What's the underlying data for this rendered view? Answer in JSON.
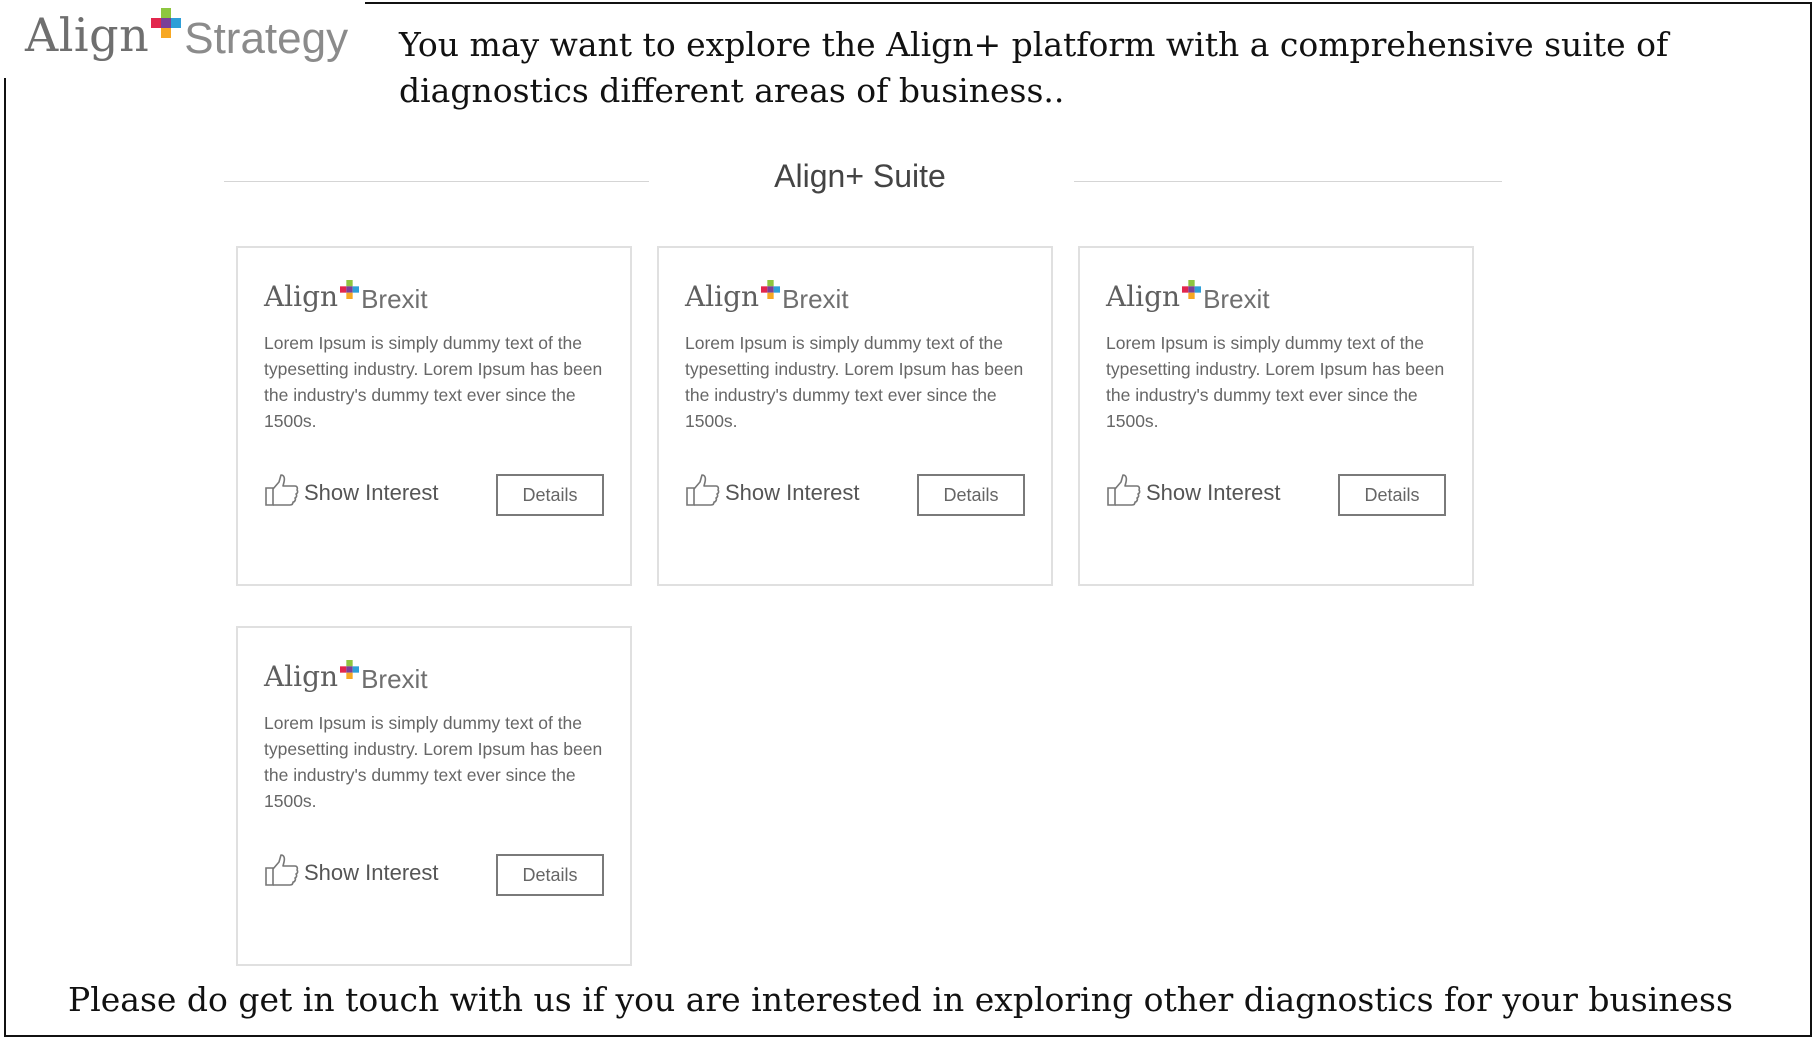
{
  "header": {
    "logo": {
      "brand": "Align",
      "product": "Strategy"
    },
    "intro_text": "You may want to explore the Align+ platform with a comprehensive suite of diagnostics different areas of business.."
  },
  "suite": {
    "title": "Align+ Suite",
    "cards": [
      {
        "logo_brand": "Align",
        "logo_product": "Brexit",
        "description": "Lorem Ipsum is simply dummy text of the typesetting industry. Lorem Ipsum has been the industry's dummy text ever since the 1500s.",
        "show_interest_label": "Show Interest",
        "details_label": "Details"
      },
      {
        "logo_brand": "Align",
        "logo_product": "Brexit",
        "description": "Lorem Ipsum is simply dummy text of the typesetting industry. Lorem Ipsum has been the industry's dummy text ever since the 1500s.",
        "show_interest_label": "Show Interest",
        "details_label": "Details"
      },
      {
        "logo_brand": "Align",
        "logo_product": "Brexit",
        "description": "Lorem Ipsum is simply dummy text of the typesetting industry. Lorem Ipsum has been the industry's dummy text ever since the 1500s.",
        "show_interest_label": "Show Interest",
        "details_label": "Details"
      },
      {
        "logo_brand": "Align",
        "logo_product": "Brexit",
        "description": "Lorem Ipsum is simply dummy text of the typesetting industry. Lorem Ipsum has been the industry's dummy text ever since the 1500s.",
        "show_interest_label": "Show Interest",
        "details_label": "Details"
      }
    ]
  },
  "footer": {
    "text": "Please do get in touch with us if you are interested in exploring other diagnostics for your business"
  },
  "colors": {
    "logo_plus_green": "#8dc63f",
    "logo_plus_red": "#e2264d",
    "logo_plus_blue": "#2e9fd8",
    "logo_plus_orange": "#f7a823",
    "logo_plus_purple": "#7b3f98"
  }
}
